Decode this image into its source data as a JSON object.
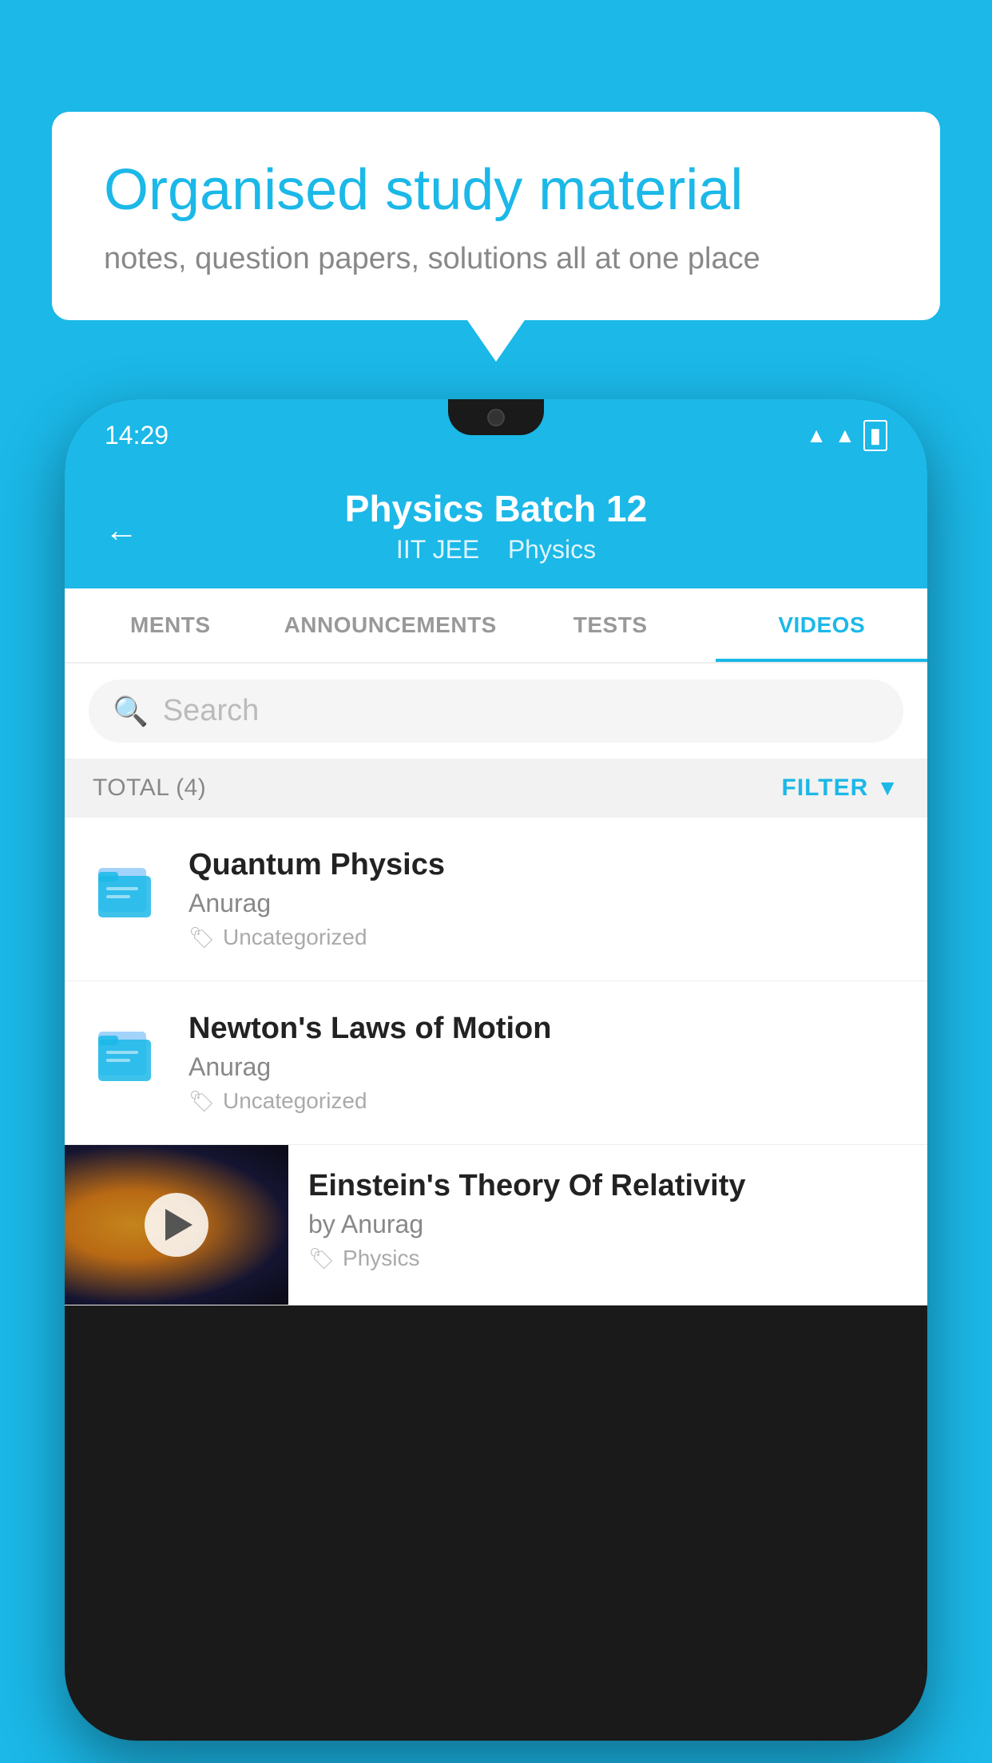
{
  "background_color": "#1bb8e8",
  "speech_bubble": {
    "title": "Organised study material",
    "subtitle": "notes, question papers, solutions all at one place"
  },
  "phone": {
    "status_bar": {
      "time": "14:29"
    },
    "header": {
      "title": "Physics Batch 12",
      "subtitle_parts": [
        "IIT JEE",
        "Physics"
      ],
      "back_label": "←"
    },
    "tabs": [
      {
        "label": "MENTS",
        "active": false
      },
      {
        "label": "ANNOUNCEMENTS",
        "active": false
      },
      {
        "label": "TESTS",
        "active": false
      },
      {
        "label": "VIDEOS",
        "active": true
      }
    ],
    "search": {
      "placeholder": "Search"
    },
    "filter_bar": {
      "total_label": "TOTAL (4)",
      "filter_label": "FILTER"
    },
    "list_items": [
      {
        "id": 1,
        "title": "Quantum Physics",
        "author": "Anurag",
        "tag": "Uncategorized",
        "type": "file"
      },
      {
        "id": 2,
        "title": "Newton's Laws of Motion",
        "author": "Anurag",
        "tag": "Uncategorized",
        "type": "file"
      },
      {
        "id": 3,
        "title": "Einstein's Theory Of Relativity",
        "author": "by Anurag",
        "tag": "Physics",
        "type": "video"
      }
    ]
  }
}
